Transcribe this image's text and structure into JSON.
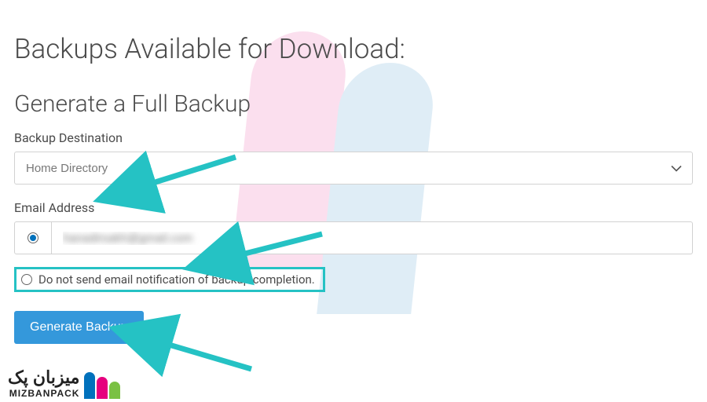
{
  "page": {
    "title": "Backups Available for Download:"
  },
  "section": {
    "title": "Generate a Full Backup"
  },
  "destination": {
    "label": "Backup Destination",
    "selected": "Home Directory"
  },
  "email": {
    "label": "Email Address",
    "value_masked": "hanadirsakh@gmail.com",
    "send_selected": true,
    "no_send_label": "Do not send email notification of backup completion."
  },
  "actions": {
    "generate_label": "Generate Backup"
  },
  "branding": {
    "name_fa": "میزبان پک",
    "name_en": "MIZBANPACK"
  },
  "colors": {
    "accent": "#25c2c4",
    "button": "#3498db",
    "radio": "#0071bc"
  }
}
